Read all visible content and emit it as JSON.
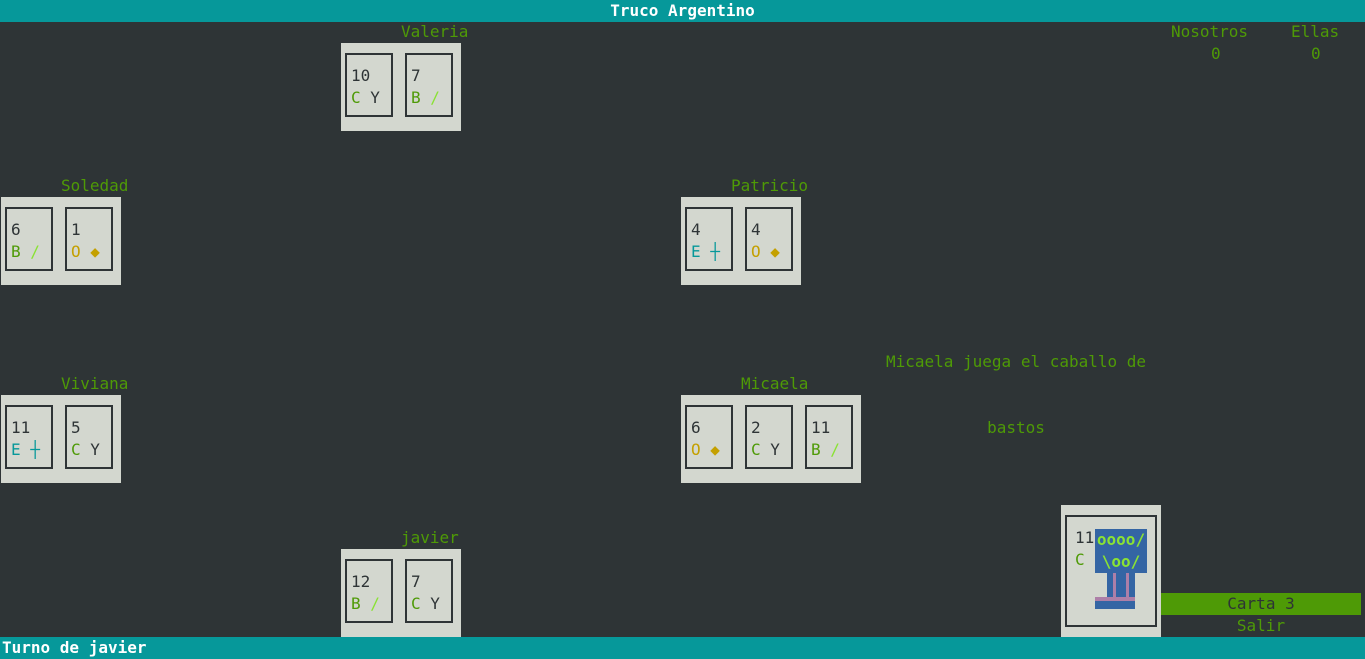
{
  "app": {
    "title": "Truco Argentino"
  },
  "score": {
    "team1_label": "Nosotros",
    "team1_value": "0",
    "team2_label": "Ellas",
    "team2_value": "0"
  },
  "players": {
    "valeria": {
      "name": "Valeria",
      "cards": [
        {
          "num": "10",
          "suit": "C",
          "glyph": "Y"
        },
        {
          "num": "7",
          "suit": "B",
          "glyph": "/"
        }
      ]
    },
    "soledad": {
      "name": "Soledad",
      "cards": [
        {
          "num": "6",
          "suit": "B",
          "glyph": "/"
        },
        {
          "num": "1",
          "suit": "O",
          "glyph": "◆"
        }
      ]
    },
    "patricio": {
      "name": "Patricio",
      "cards": [
        {
          "num": "4",
          "suit": "E",
          "glyph": "┼"
        },
        {
          "num": "4",
          "suit": "O",
          "glyph": "◆"
        }
      ]
    },
    "viviana": {
      "name": "Viviana",
      "cards": [
        {
          "num": "11",
          "suit": "E",
          "glyph": "┼"
        },
        {
          "num": "5",
          "suit": "C",
          "glyph": "Y"
        }
      ]
    },
    "micaela": {
      "name": "Micaela",
      "cards": [
        {
          "num": "6",
          "suit": "O",
          "glyph": "◆"
        },
        {
          "num": "2",
          "suit": "C",
          "glyph": "Y"
        },
        {
          "num": "11",
          "suit": "B",
          "glyph": "/"
        }
      ]
    },
    "javier": {
      "name": "javier",
      "cards": [
        {
          "num": "12",
          "suit": "B",
          "glyph": "/"
        },
        {
          "num": "7",
          "suit": "C",
          "glyph": "Y"
        }
      ]
    }
  },
  "message": {
    "line1": "Micaela juega el caballo de",
    "line2": "bastos"
  },
  "played_card": {
    "num": "11",
    "suit": "C",
    "art_line1": "oooo/",
    "art_line2": "\\oo/"
  },
  "menu": {
    "carta": "Carta 3",
    "salir": "Salir"
  },
  "status": {
    "text": "Turno de javier"
  },
  "colors": {
    "teal": "#06989a",
    "green": "#4e9a06",
    "yellow": "#c4a000",
    "card_bg": "#d3d7cf",
    "bg": "#2e3436"
  }
}
